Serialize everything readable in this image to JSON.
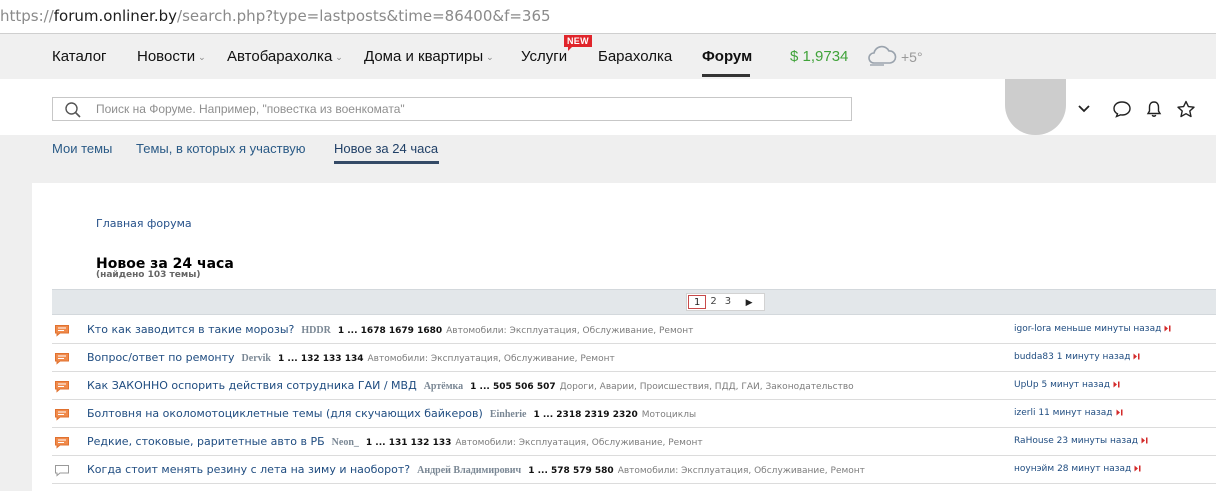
{
  "browser": {
    "url_scheme": "https://",
    "url_host": "forum.onliner.by",
    "url_path": "/search.php?type=lastposts&time=86400&f=365"
  },
  "topnav": {
    "catalog": "Каталог",
    "news": "Новости",
    "auto": "Автобарахолка",
    "realty": "Дома и квартиры",
    "services": "Услуги",
    "services_badge": "NEW",
    "baraholka": "Барахолка",
    "forum": "Форум",
    "rate": "$ 1,9734",
    "temperature": "+5°",
    "weather_icon": "cloud-icon"
  },
  "search": {
    "placeholder": "Поиск на Форуме. Например, \"повестка из военкомата\""
  },
  "tabs": {
    "my_topics": "Мои темы",
    "participating": "Темы, в которых я участвую",
    "new_24h": "Новое за 24 часа"
  },
  "breadcrumb": "Главная форума",
  "page_title": "Новое за 24 часа",
  "found": "(найдено 103 темы)",
  "pager": {
    "pages": [
      "1",
      "2",
      "3"
    ],
    "current": "1",
    "next": "▶"
  },
  "colors": {
    "accent_green": "#40a33a",
    "badge_red": "#e0252b",
    "link_blue": "#1f4c80"
  },
  "topics": [
    {
      "title": "Кто как заводится в такие морозы?",
      "author": "HDDR",
      "pages_first": "1",
      "ellipsis": "...",
      "pages_last": [
        "1678",
        "1679",
        "1680"
      ],
      "category": "Автомобили: Эксплуатация, Обслуживание, Ремонт",
      "last_user": "igor-lora",
      "last_time": "меньше минуты назад",
      "unread": true
    },
    {
      "title": "Вопрос/ответ по ремонту",
      "author": "Dervik",
      "pages_first": "1",
      "ellipsis": "...",
      "pages_last": [
        "132",
        "133",
        "134"
      ],
      "category": "Автомобили: Эксплуатация, Обслуживание, Ремонт",
      "last_user": "budda83",
      "last_time": "1 минуту назад",
      "unread": true
    },
    {
      "title": "Как ЗАКОННО оспорить действия сотрудника ГАИ / МВД",
      "author": "Артёмка",
      "pages_first": "1",
      "ellipsis": "...",
      "pages_last": [
        "505",
        "506",
        "507"
      ],
      "category": "Дороги, Аварии, Происшествия, ПДД, ГАИ, Законодательство",
      "last_user": "UpUp",
      "last_time": "5 минут назад",
      "unread": true
    },
    {
      "title": "Болтовня на околомотоциклетные темы (для скучающих байкеров)",
      "author": "Einherie",
      "pages_first": "1",
      "ellipsis": "...",
      "pages_last": [
        "2318",
        "2319",
        "2320"
      ],
      "category": "Мотоциклы",
      "last_user": "izerli",
      "last_time": "11 минут назад",
      "unread": true
    },
    {
      "title": "Редкие, стоковые, раритетные авто в РБ",
      "author": "Neon_",
      "pages_first": "1",
      "ellipsis": "...",
      "pages_last": [
        "131",
        "132",
        "133"
      ],
      "category": "Автомобили: Эксплуатация, Обслуживание, Ремонт",
      "last_user": "RaHouse",
      "last_time": "23 минуты назад",
      "unread": true
    },
    {
      "title": "Когда стоит менять резину с лета на зиму и наоборот?",
      "author": "Андрей Владимирович",
      "pages_first": "1",
      "ellipsis": "...",
      "pages_last": [
        "578",
        "579",
        "580"
      ],
      "category": "Автомобили: Эксплуатация, Обслуживание, Ремонт",
      "last_user": "ноунэйм",
      "last_time": "28 минут назад",
      "unread": false
    }
  ]
}
